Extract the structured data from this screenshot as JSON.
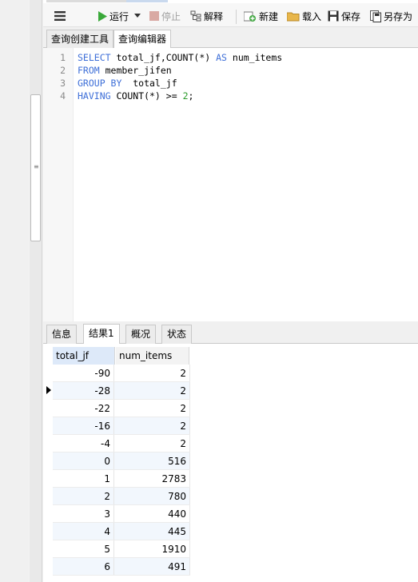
{
  "toolbar": {
    "run_label": "运行",
    "stop_label": "停止",
    "explain_label": "解释",
    "new_label": "新建",
    "load_label": "载入",
    "save_label": "保存",
    "save_as_label": "另存为"
  },
  "editor_tabs": [
    {
      "label": "查询创建工具"
    },
    {
      "label": "查询编辑器"
    }
  ],
  "sql": {
    "line_numbers": [
      "1",
      "2",
      "3",
      "4"
    ],
    "line1": {
      "kw1": "SELECT",
      "t1": " total_jf,COUNT(*) ",
      "kw2": "AS",
      "t2": " num_items"
    },
    "line2": {
      "kw1": "FROM",
      "t1": " member_jifen"
    },
    "line3": {
      "kw1": "GROUP BY",
      "t1": "  total_jf"
    },
    "line4": {
      "kw1": "HAVING",
      "t1": " COUNT(*) >= ",
      "num": "2",
      "t2": ";"
    }
  },
  "result_tabs": [
    {
      "label": "信息"
    },
    {
      "label": "结果1"
    },
    {
      "label": "概况"
    },
    {
      "label": "状态"
    }
  ],
  "results": {
    "columns": [
      "total_jf",
      "num_items"
    ],
    "rows": [
      [
        "-90",
        "2"
      ],
      [
        "-28",
        "2"
      ],
      [
        "-22",
        "2"
      ],
      [
        "-16",
        "2"
      ],
      [
        "-4",
        "2"
      ],
      [
        "0",
        "516"
      ],
      [
        "1",
        "2783"
      ],
      [
        "2",
        "780"
      ],
      [
        "3",
        "440"
      ],
      [
        "4",
        "445"
      ],
      [
        "5",
        "1910"
      ],
      [
        "6",
        "491"
      ]
    ]
  }
}
